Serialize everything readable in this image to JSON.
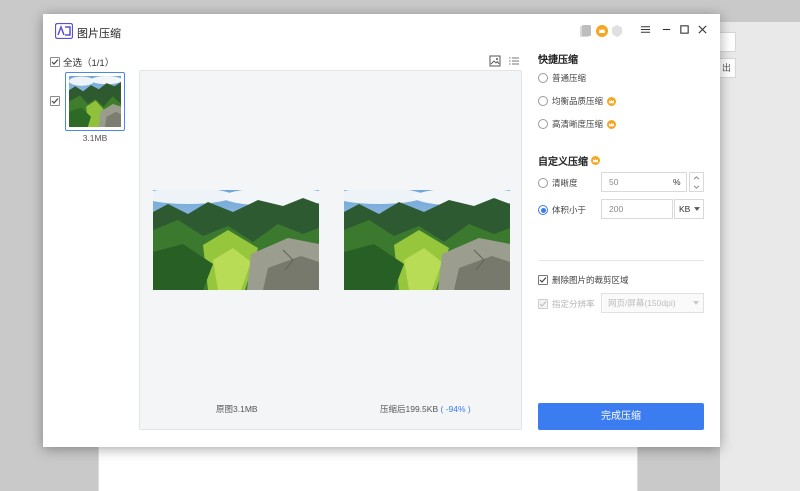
{
  "app": {
    "title": "图片压缩"
  },
  "left": {
    "select_all_label": "全选（1/1）",
    "items": [
      {
        "size": "3.1MB"
      }
    ]
  },
  "preview": {
    "original_caption": "原图3.1MB",
    "compressed_caption": "压缩后199.5KB",
    "compressed_pct": "( -94% )"
  },
  "quick": {
    "title": "快捷压缩",
    "options": [
      {
        "label": "普通压缩"
      },
      {
        "label": "均衡品质压缩"
      },
      {
        "label": "高清晰度压缩"
      }
    ]
  },
  "custom": {
    "title": "自定义压缩",
    "clarity": {
      "label": "清晰度",
      "value": "50",
      "unit": "%"
    },
    "size_limit": {
      "label": "体积小于",
      "value": "200",
      "unit": "KB"
    }
  },
  "options": {
    "delete_crop_label": "删除图片的裁剪区域",
    "resolution_label": "指定分辨率",
    "resolution_value": "网页/屏幕(150dpi)"
  },
  "done_button": "完成压缩",
  "colors": {
    "accent": "#3b7cf0",
    "vip": "#f5a623"
  },
  "icons": [
    "app-logo-icon",
    "vip-crown-icon",
    "menu-icon",
    "minimize-icon",
    "maximize-icon",
    "close-icon",
    "grid-view-icon",
    "list-view-icon",
    "checkmark-icon",
    "chevron-down-icon"
  ]
}
